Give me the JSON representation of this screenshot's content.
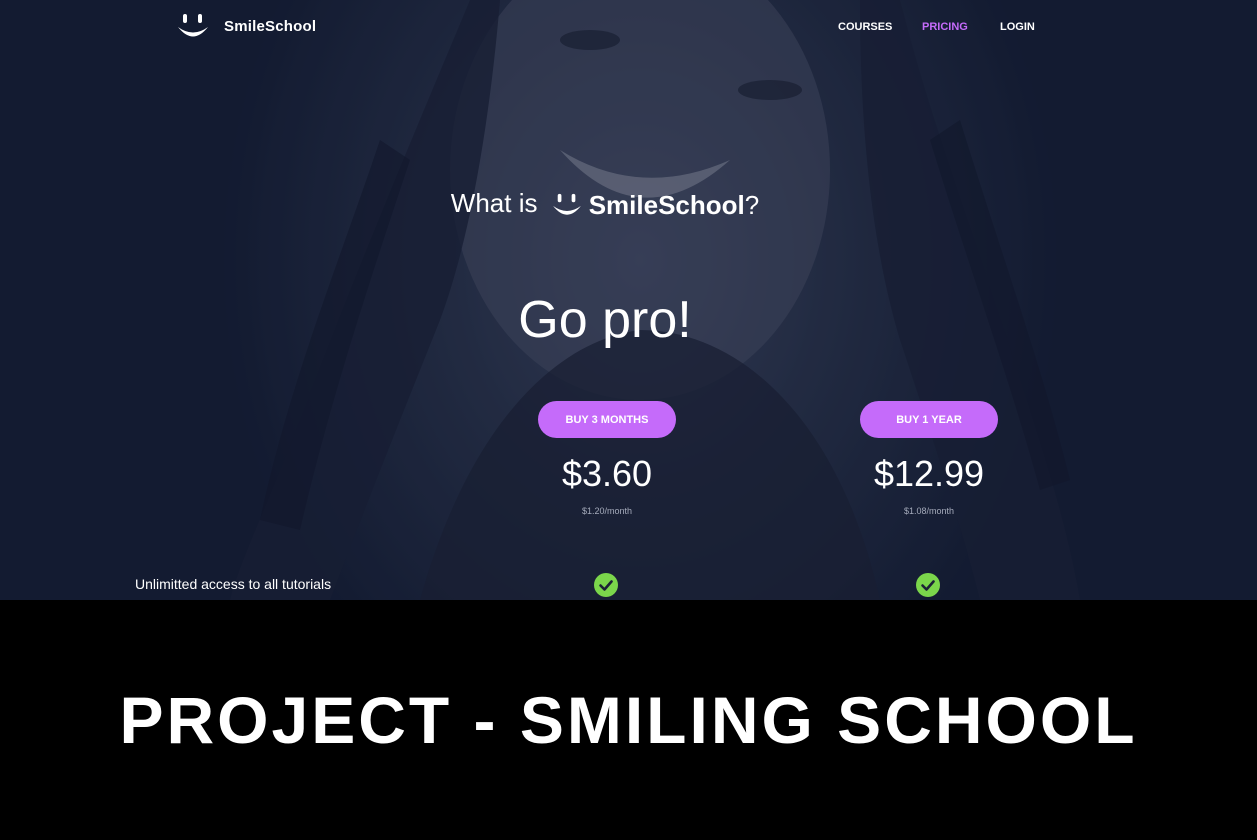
{
  "brand": {
    "name": "SmileSchool"
  },
  "nav": {
    "items": [
      {
        "label": "COURSES"
      },
      {
        "label": "PRICING",
        "active": true
      },
      {
        "label": "LOGIN"
      }
    ]
  },
  "hero": {
    "what_prefix": "What is",
    "what_brand": "SmileSchool",
    "what_suffix": "?",
    "headline": "Go pro!"
  },
  "plans": [
    {
      "button": "BUY 3 MONTHS",
      "price": "$3.60",
      "per_month": "$1.20/month"
    },
    {
      "button": "BUY 1 YEAR",
      "price": "$12.99",
      "per_month": "$1.08/month"
    }
  ],
  "features": [
    {
      "label": "Unlimitted access to all tutorials",
      "plan1": true,
      "plan2": true
    }
  ],
  "banner": {
    "title": "PROJECT - SMILING SCHOOL"
  },
  "colors": {
    "accent": "#c56bfa",
    "check": "#7bd64b",
    "hero_bg": "#1e2640",
    "banner_bg": "#000000"
  },
  "icons": {
    "logo": "smiley-icon",
    "check": "check-circle-icon"
  }
}
